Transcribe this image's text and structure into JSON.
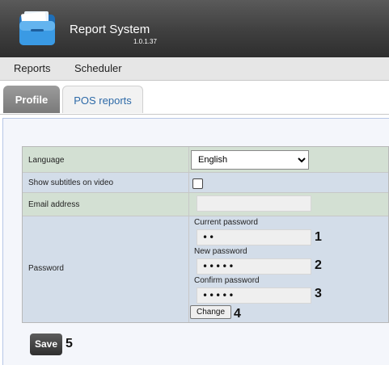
{
  "app": {
    "title": "Report System",
    "version": "1.0.1.37"
  },
  "menu": {
    "items": [
      "Reports",
      "Scheduler"
    ]
  },
  "tabs": {
    "profile": "Profile",
    "pos_reports": "POS reports"
  },
  "form": {
    "language_label": "Language",
    "language_value": "English",
    "subtitles_label": "Show subtitles on video",
    "subtitles_checked": false,
    "email_label": "Email address",
    "email_value": "",
    "password_label": "Password",
    "current_password_label": "Current password",
    "current_password_value": "••",
    "new_password_label": "New password",
    "new_password_value": "•••••",
    "confirm_password_label": "Confirm password",
    "confirm_password_value": "•••••",
    "change_button": "Change",
    "save_button": "Save"
  },
  "callouts": [
    "1",
    "2",
    "3",
    "4",
    "5"
  ]
}
